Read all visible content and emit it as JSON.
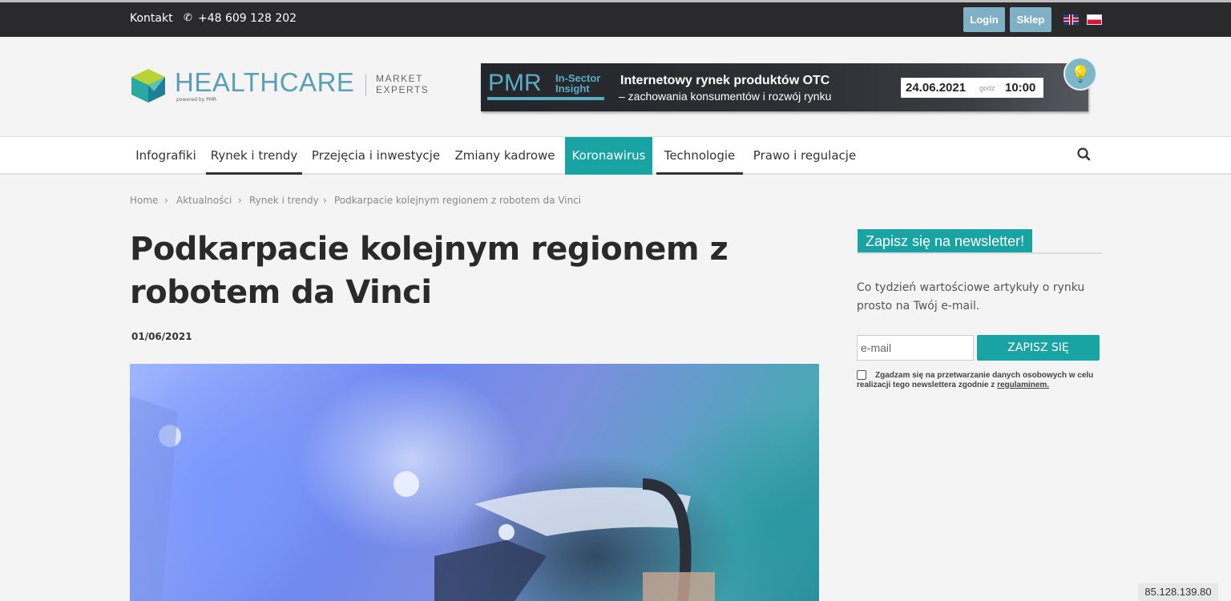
{
  "topbar": {
    "contact": "Kontakt",
    "phone_icon": "phone-icon",
    "phone": "+48 609 128 202",
    "login": "Login",
    "shop": "Sklep",
    "flags": [
      "uk-flag-icon",
      "pl-flag-icon"
    ]
  },
  "header": {
    "logo_text": "HEALTHCARE",
    "logo_powered": "powered by PMR",
    "logo_market": "MARKET",
    "logo_experts": "EXPERTS",
    "banner": {
      "pmr": "PMR",
      "insight_line1": "In-Sector",
      "insight_line2": "Insight",
      "title1": "Internetowy rynek produktów OTC",
      "title2": "– zachowania konsumentów i rozwój rynku",
      "date": "24.06.2021",
      "godz": "godz",
      "hour": "10:00"
    }
  },
  "nav": {
    "items": [
      {
        "label": "Infografiki"
      },
      {
        "label": "Rynek i trendy"
      },
      {
        "label": "Przejęcia i inwestycje"
      },
      {
        "label": "Zmiany kadrowe"
      },
      {
        "label": "Koronawirus"
      },
      {
        "label": "Technologie"
      },
      {
        "label": "Prawo i regulacje"
      }
    ],
    "search_icon": "search-icon"
  },
  "breadcrumb": {
    "items": [
      "Home",
      "Aktualności",
      "Rynek i trendy",
      "Podkarpacie kolejnym regionem z robotem da Vinci"
    ],
    "separator": "›"
  },
  "article": {
    "title": "Podkarpacie kolejnym regionem z robotem da Vinci",
    "date": "01/06/2021"
  },
  "newsletter": {
    "heading": "Zapisz się na newsletter!",
    "description": "Co tydzień wartościowe artykuły o rynku prosto na Twój e-mail.",
    "email_placeholder": "e-mail",
    "submit": "ZAPISZ SIĘ",
    "consent": "Zgadzam się na przetwarzanie danych osobowych w celu realizacji tego newslettera zgodnie z",
    "consent_link": "regulaminem."
  },
  "ip_badge": "85.128.139.80"
}
